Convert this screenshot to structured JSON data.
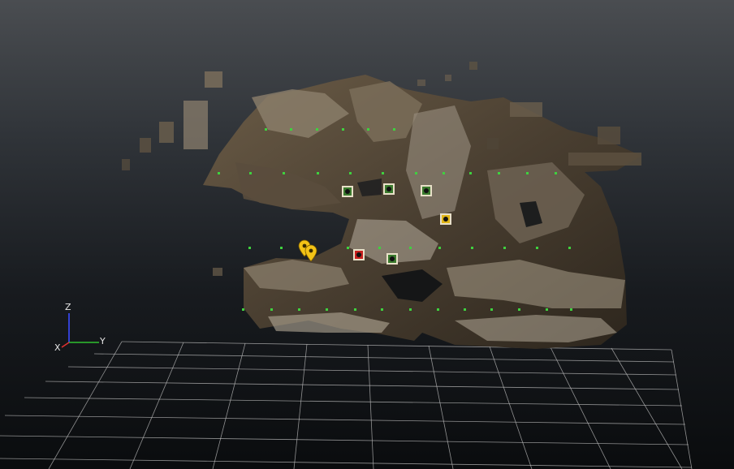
{
  "axes": {
    "z_label": "Z",
    "y_label": "Y",
    "x_label": "X"
  },
  "colors": {
    "tie_point": "#3fd13f",
    "marker_green": "#3b7a2e",
    "marker_yellow": "#e0b516",
    "marker_red": "#c8201e",
    "pin_yellow": "#f3c316",
    "grid": "#bcbcbc"
  },
  "markers": [
    {
      "status": "green",
      "icon": "camera-marker-icon"
    },
    {
      "status": "green",
      "icon": "camera-marker-icon"
    },
    {
      "status": "green",
      "icon": "camera-marker-icon"
    },
    {
      "status": "yellow",
      "icon": "camera-marker-icon"
    },
    {
      "status": "red",
      "icon": "camera-marker-icon"
    },
    {
      "status": "green",
      "icon": "camera-marker-icon"
    }
  ],
  "pins": [
    {
      "color": "yellow",
      "icon": "location-pin-icon"
    },
    {
      "color": "yellow",
      "icon": "location-pin-icon"
    }
  ]
}
